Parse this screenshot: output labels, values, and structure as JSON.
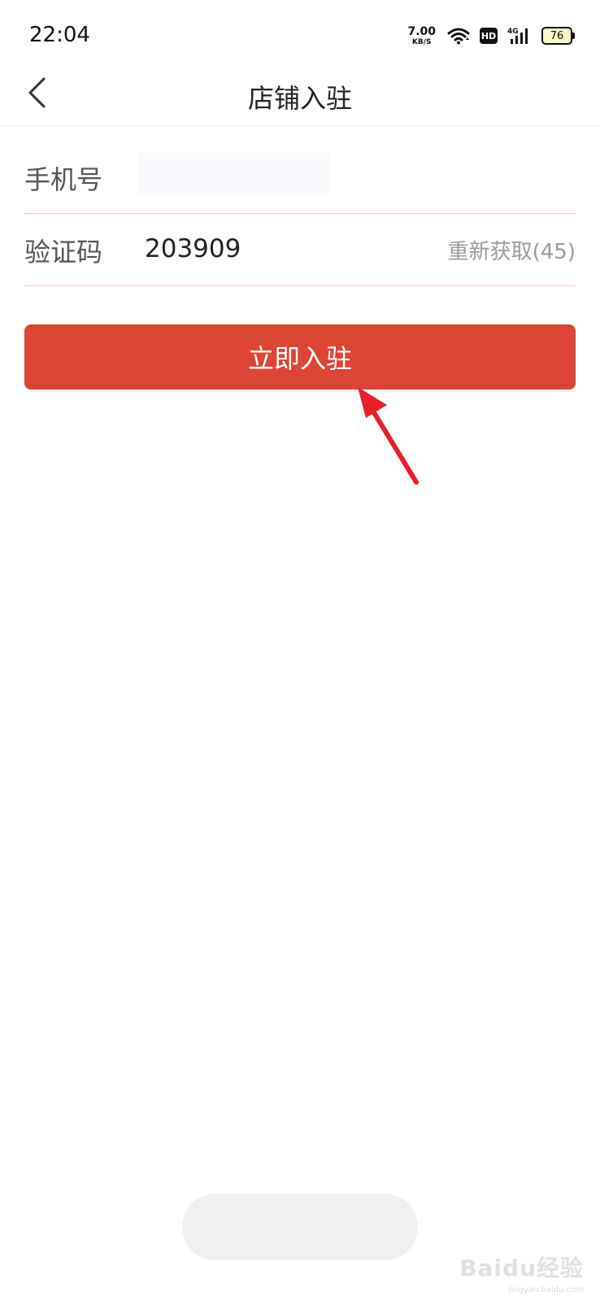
{
  "status_bar": {
    "time": "22:04",
    "net_speed_value": "7.00",
    "net_speed_unit": "KB/S",
    "hd_label": "HD",
    "network_label": "4G",
    "battery_level": "76",
    "icons": [
      "wifi-icon",
      "hd-icon",
      "signal-4g-icon",
      "battery-icon"
    ]
  },
  "nav": {
    "title": "店铺入驻",
    "back_icon": "chevron-left-icon"
  },
  "form": {
    "phone_label": "手机号",
    "phone_value": "",
    "code_label": "验证码",
    "code_value": "203909",
    "resend_label": "重新获取(45)"
  },
  "submit": {
    "label": "立即入驻"
  },
  "watermark": {
    "logo": "Baidu经验",
    "url": "jingyan.baidu.com"
  },
  "colors": {
    "accent": "#dc4535",
    "annotation_arrow": "#e8202a"
  }
}
